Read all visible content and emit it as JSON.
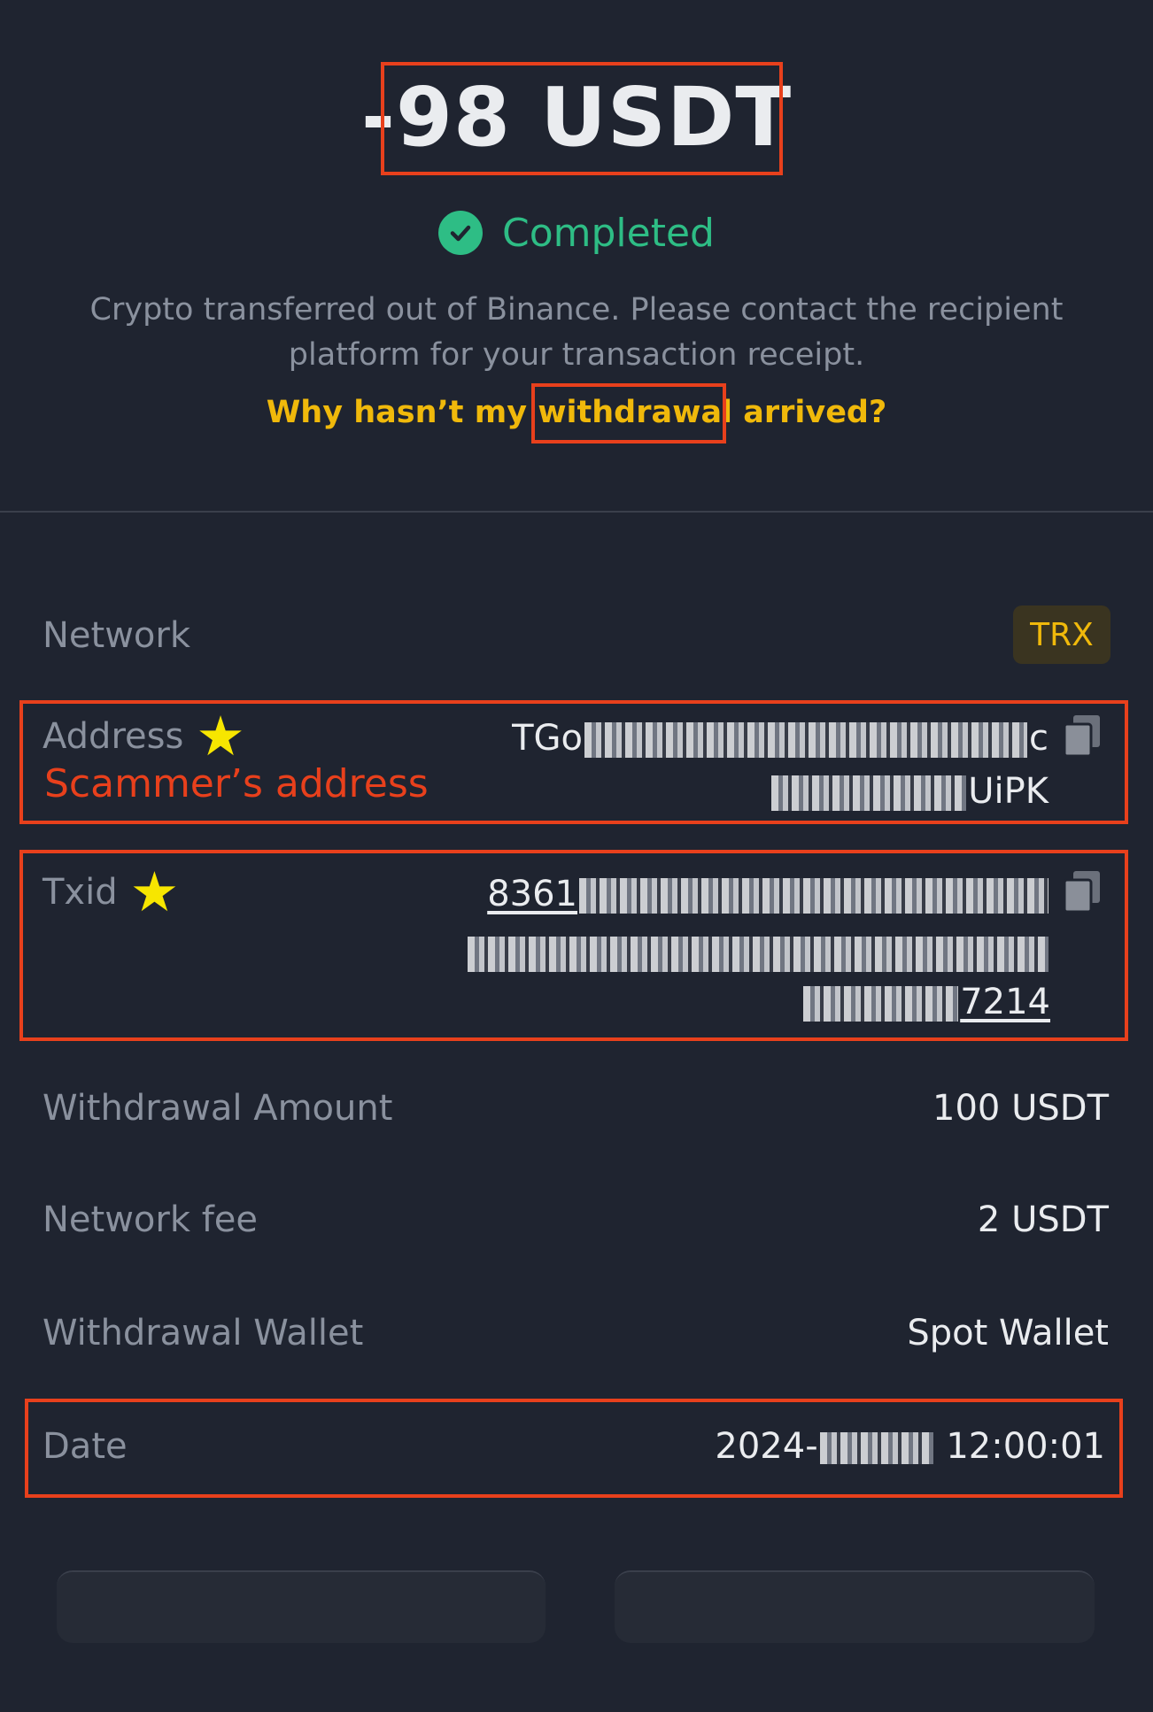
{
  "header": {
    "amount": "-98 USDT",
    "status": "Completed",
    "description": "Crypto transferred out of Binance. Please contact the recipient platform for your transaction receipt.",
    "help_link": "Why hasn’t my withdrawal arrived?"
  },
  "details": {
    "network": {
      "label": "Network",
      "value": "TRX"
    },
    "address": {
      "label": "Address",
      "annotation": "Scammer’s address",
      "line1_prefix": "TGo",
      "line1_suffix": "c",
      "line2_suffix": "UiPK"
    },
    "txid": {
      "label": "Txid",
      "line1_prefix": "8361",
      "line3_suffix": "7214"
    },
    "withdrawal_amount": {
      "label": "Withdrawal Amount",
      "value": "100 USDT"
    },
    "network_fee": {
      "label": "Network fee",
      "value": "2 USDT"
    },
    "withdrawal_wallet": {
      "label": "Withdrawal Wallet",
      "value": "Spot Wallet"
    },
    "date": {
      "label": "Date",
      "prefix": "2024-",
      "suffix": "12:00:01"
    }
  },
  "colors": {
    "background": "#1f2430",
    "accent_yellow": "#f0b90b",
    "success_green": "#2ebd85",
    "annotation_red": "#e8401c",
    "star_yellow": "#f7e600"
  },
  "icons": [
    "check-circle-icon",
    "copy-icon",
    "star-icon"
  ]
}
